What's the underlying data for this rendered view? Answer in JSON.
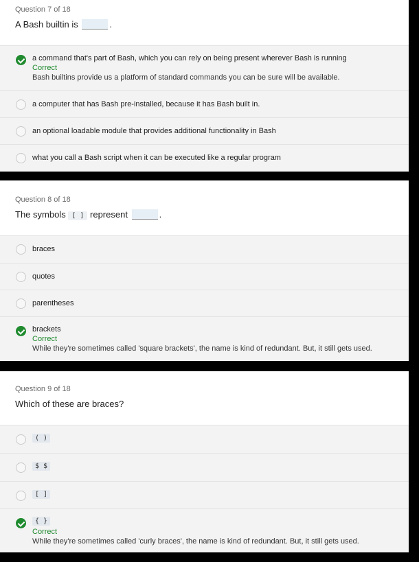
{
  "questions": [
    {
      "counter": "Question 7 of 18",
      "prompt_before": "A Bash builtin is",
      "prompt_after": ".",
      "options": [
        {
          "label": "a command that's part of Bash, which you can rely on being present wherever Bash is running",
          "selected": true,
          "feedback": "Correct",
          "explanation": "Bash builtins provide us a platform of standard commands you can be sure will be available."
        },
        {
          "label": "a computer that has Bash pre-installed, because it has Bash built in.",
          "selected": false
        },
        {
          "label": "an optional loadable module that provides additional functionality in Bash",
          "selected": false
        },
        {
          "label": "what you call a Bash script when it can be executed like a regular program",
          "selected": false
        }
      ]
    },
    {
      "counter": "Question 8 of 18",
      "prompt_before": "The symbols",
      "prompt_code": "[ ]",
      "prompt_mid": "represent",
      "prompt_after": ".",
      "options": [
        {
          "label": "braces",
          "selected": false
        },
        {
          "label": "quotes",
          "selected": false
        },
        {
          "label": "parentheses",
          "selected": false
        },
        {
          "label": "brackets",
          "selected": true,
          "feedback": "Correct",
          "explanation": "While they're sometimes called 'square brackets', the name is kind of redundant. But, it still gets used."
        }
      ]
    },
    {
      "counter": "Question 9 of 18",
      "prompt": "Which of these are braces?",
      "options": [
        {
          "label": "( )",
          "selected": false
        },
        {
          "label": "$ $",
          "selected": false
        },
        {
          "label": "[ ]",
          "selected": false
        },
        {
          "label": "{ }",
          "selected": true,
          "feedback": "Correct",
          "explanation": "While they're sometimes called 'curly braces', the name is kind of redundant. But, it still gets used."
        }
      ]
    }
  ],
  "colors": {
    "correct": "#1f8a2e",
    "option_bg": "#f3f3f3",
    "separator": "#000000"
  }
}
